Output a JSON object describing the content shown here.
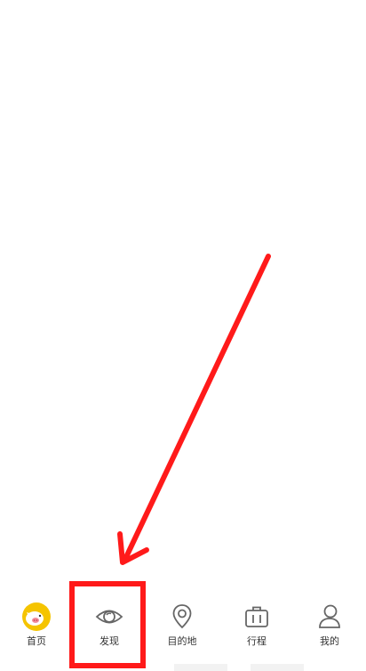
{
  "tabbar": {
    "items": [
      {
        "label": "首页",
        "icon": "mascot-pig-icon"
      },
      {
        "label": "发现",
        "icon": "eye-icon"
      },
      {
        "label": "目的地",
        "icon": "location-pin-icon"
      },
      {
        "label": "行程",
        "icon": "suitcase-icon"
      },
      {
        "label": "我的",
        "icon": "person-icon"
      }
    ]
  },
  "annotation": {
    "arrow_color": "#ff1a1a",
    "highlight_box_color": "#ff1a1a",
    "highlighted_tab": "发现"
  }
}
